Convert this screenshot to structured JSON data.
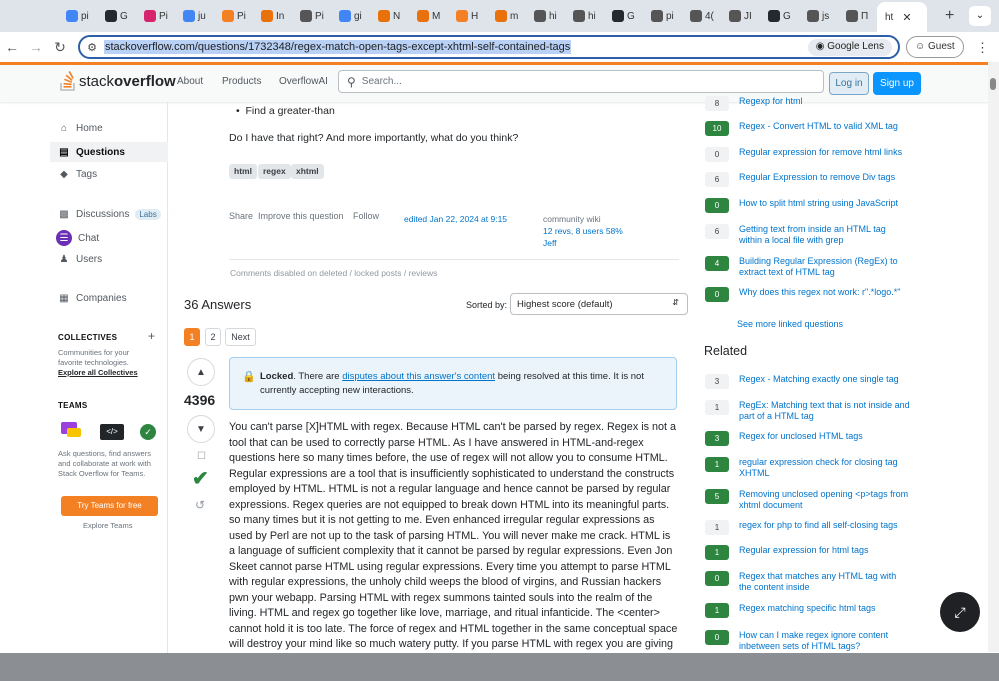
{
  "browser": {
    "tabs": [
      {
        "label": "pi",
        "color": "#4285f4"
      },
      {
        "label": "G",
        "color": "#24292f"
      },
      {
        "label": "Pi",
        "color": "#d6246e"
      },
      {
        "label": "ju",
        "color": "#4285f4"
      },
      {
        "label": "Pi",
        "color": "#f48024"
      },
      {
        "label": "In",
        "color": "#e8710a"
      },
      {
        "label": "Pi",
        "color": "#555"
      },
      {
        "label": "gi",
        "color": "#4285f4"
      },
      {
        "label": "N",
        "color": "#e8710a"
      },
      {
        "label": "M",
        "color": "#e8710a"
      },
      {
        "label": "H",
        "color": "#f48024"
      },
      {
        "label": "m",
        "color": "#e8710a"
      },
      {
        "label": "hi",
        "color": "#555"
      },
      {
        "label": "hi",
        "color": "#555"
      },
      {
        "label": "G",
        "color": "#24292f"
      },
      {
        "label": "pi",
        "color": "#555"
      },
      {
        "label": "4(",
        "color": "#555"
      },
      {
        "label": "JI",
        "color": "#555"
      },
      {
        "label": "G",
        "color": "#24292f"
      },
      {
        "label": "js",
        "color": "#555"
      },
      {
        "label": "Π",
        "color": "#555"
      }
    ],
    "active_tab": "ht",
    "url": "stackoverflow.com/questions/1732348/regex-match-open-tags-except-xhtml-self-contained-tags",
    "lens_label": "Google Lens",
    "profile_label": "Guest"
  },
  "header": {
    "logo_part1": "stack",
    "logo_part2": "overflow",
    "nav": [
      "About",
      "Products",
      "OverflowAI"
    ],
    "search_placeholder": "Search...",
    "login": "Log in",
    "signup": "Sign up"
  },
  "sidebar": {
    "home": "Home",
    "questions": "Questions",
    "tags": "Tags",
    "discussions": "Discussions",
    "labs": "Labs",
    "chat": "Chat",
    "users": "Users",
    "companies": "Companies",
    "collectives_title": "COLLECTIVES",
    "collectives_desc": "Communities for your favorite technologies.",
    "collectives_link": "Explore all Collectives",
    "teams_title": "TEAMS",
    "teams_desc": "Ask questions, find answers and collaborate at work with Stack Overflow for Teams.",
    "teams_btn": "Try Teams for free",
    "teams_explore": "Explore Teams"
  },
  "question": {
    "bullet": "Find a greater-than",
    "closing": "Do I have that right? And more importantly, what do you think?",
    "tags": [
      "html",
      "regex",
      "xhtml"
    ],
    "share": "Share",
    "improve": "Improve this question",
    "follow": "Follow",
    "edited": "edited Jan 22, 2024 at 9:15",
    "wiki": "community wiki",
    "revs": "12 revs, 8 users 58%",
    "user": "Jeff",
    "comments_disabled": "Comments disabled on deleted / locked posts / reviews"
  },
  "answers": {
    "count_label": "36 Answers",
    "sorted_label": "Sorted by:",
    "sort_value": "Highest score (default)",
    "pages": [
      "1",
      "2",
      "Next"
    ],
    "score": "4396",
    "locked_bold": "Locked",
    "locked_pre": ". There are ",
    "locked_link": "disputes about this answer's content",
    "locked_post": " being resolved at this time. It is not currently accepting new interactions.",
    "body": "You can't parse [X]HTML with regex. Because HTML can't be parsed by regex. Regex is not a tool that can be used to correctly parse HTML. As I have answered in HTML-and-regex questions here so many times before, the use of regex will not allow you to consume HTML. Regular expressions are a tool that is insufficiently sophisticated to understand the constructs employed by HTML. HTML is not a regular language and hence cannot be parsed by regular expressions. Regex queries are not equipped to break down HTML into its meaningful parts. so many times but it is not getting to me. Even enhanced irregular regular expressions as used by Perl are not up to the task of parsing HTML. You will never make me crack. HTML is a language of sufficient complexity that it cannot be parsed by regular expressions. Even Jon Skeet cannot parse HTML using regular expressions. Every time you attempt to parse HTML with regular expressions, the unholy child weeps the blood of virgins, and Russian hackers pwn your webapp. Parsing HTML with regex summons tainted souls into the realm of the living. HTML and regex go together like love, marriage, and ritual infanticide. The <center> cannot hold it is too late. The force of regex and HTML together in the same conceptual space will destroy your mind like so much watery putty. If you parse HTML with regex you are giving"
  },
  "linked": [
    {
      "count": "8",
      "accepted": false,
      "title": "Regexp for html"
    },
    {
      "count": "10",
      "accepted": true,
      "title": "Regex - Convert HTML to valid XML tag"
    },
    {
      "count": "0",
      "accepted": false,
      "title": "Regular expression for remove html links"
    },
    {
      "count": "6",
      "accepted": false,
      "title": "Regular Expression to remove Div tags"
    },
    {
      "count": "0",
      "accepted": true,
      "title": "How to split html string using JavaScript"
    },
    {
      "count": "6",
      "accepted": false,
      "title": "Getting text from inside an HTML tag within a local file with grep"
    },
    {
      "count": "4",
      "accepted": true,
      "title": "Building Regular Expression (RegEx) to extract text of HTML tag"
    },
    {
      "count": "0",
      "accepted": true,
      "title": "Why does this regex not work: r\".*logo.*\""
    }
  ],
  "see_more": "See more linked questions",
  "related_title": "Related",
  "related": [
    {
      "count": "3",
      "accepted": false,
      "title": "Regex - Matching exactly one single tag"
    },
    {
      "count": "1",
      "accepted": false,
      "title": "RegEx: Matching text that is not inside and part of a HTML tag"
    },
    {
      "count": "3",
      "accepted": true,
      "title": "Regex for unclosed HTML tags"
    },
    {
      "count": "1",
      "accepted": true,
      "title": "regular expression check for closing tag XHTML"
    },
    {
      "count": "5",
      "accepted": true,
      "title": "Removing unclosed opening <p>tags from xhtml document"
    },
    {
      "count": "1",
      "accepted": false,
      "title": "regex for php to find all self-closing tags"
    },
    {
      "count": "1",
      "accepted": true,
      "title": "Regular expression for html tags"
    },
    {
      "count": "0",
      "accepted": true,
      "title": "Regex that matches any HTML tag with the content inside"
    },
    {
      "count": "1",
      "accepted": true,
      "title": "Regex matching specific html tags"
    },
    {
      "count": "0",
      "accepted": true,
      "title": "How can I make regex ignore content inbetween sets of HTML tags?"
    }
  ]
}
